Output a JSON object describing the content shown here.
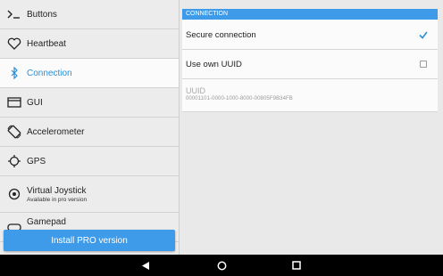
{
  "sidebar": {
    "items": [
      {
        "label": "Buttons",
        "icon": "terminal-prompt-icon"
      },
      {
        "label": "Heartbeat",
        "icon": "heart-icon"
      },
      {
        "label": "Connection",
        "icon": "bluetooth-icon",
        "active": true
      },
      {
        "label": "GUI",
        "icon": "window-icon"
      },
      {
        "label": "Accelerometer",
        "icon": "phone-rotate-icon"
      },
      {
        "label": "GPS",
        "icon": "gps-crosshair-icon"
      },
      {
        "label": "Virtual Joystick",
        "sub": "Available in pro version",
        "icon": "joystick-icon"
      },
      {
        "label": "Gamepad",
        "icon": "gamepad-icon"
      }
    ],
    "pro_button": "Install PRO version"
  },
  "main": {
    "section_title": "CONNECTION",
    "secure_connection": {
      "label": "Secure connection",
      "checked": true
    },
    "own_uuid": {
      "label": "Use own UUID",
      "checked": false
    },
    "uuid": {
      "label": "UUID",
      "value": "00001101-0000-1000-8000-00805F9B34FB"
    }
  },
  "colors": {
    "accent": "#3d9be9",
    "active_text": "#2a8fd6"
  },
  "navbar": {
    "icons": [
      "back-icon",
      "home-icon",
      "recents-icon"
    ]
  }
}
